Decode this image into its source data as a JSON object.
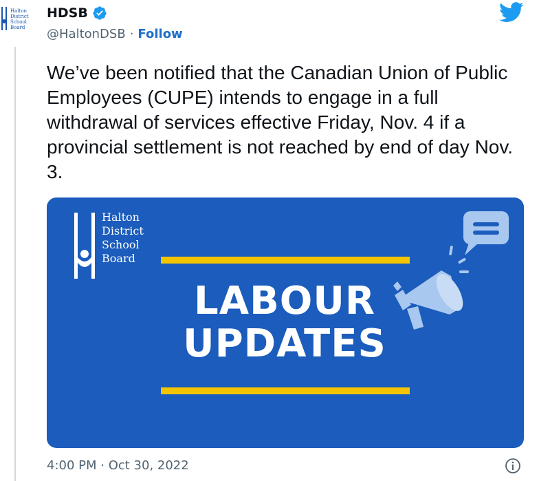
{
  "account": {
    "avatar_text": [
      "Halton",
      "District",
      "School",
      "Board"
    ],
    "display_name": "HDSB",
    "handle": "@HaltonDSB",
    "separator": "·",
    "follow_label": "Follow"
  },
  "tweet": {
    "text": "We’ve been notified that the Canadian Union of Public Employees (CUPE) intends to engage in a full withdrawal of services effective Friday, Nov. 4 if a provincial settlement is not reached by end of day Nov. 3.",
    "timestamp": "4:00 PM · Oct 30, 2022"
  },
  "media": {
    "logo_lines": [
      "Halton",
      "District",
      "School",
      "Board"
    ],
    "headline_line1": "LABOUR",
    "headline_line2": "UPDATES"
  },
  "icons": {
    "verified": "verified-badge-icon",
    "platform": "twitter-bird-icon",
    "info": "info-icon",
    "megaphone": "megaphone-icon"
  },
  "colors": {
    "media_background": "#1b5cbc",
    "accent_gold": "#f5c400",
    "link": "#1d6fc9",
    "twitter_blue": "#1d9bf0"
  }
}
